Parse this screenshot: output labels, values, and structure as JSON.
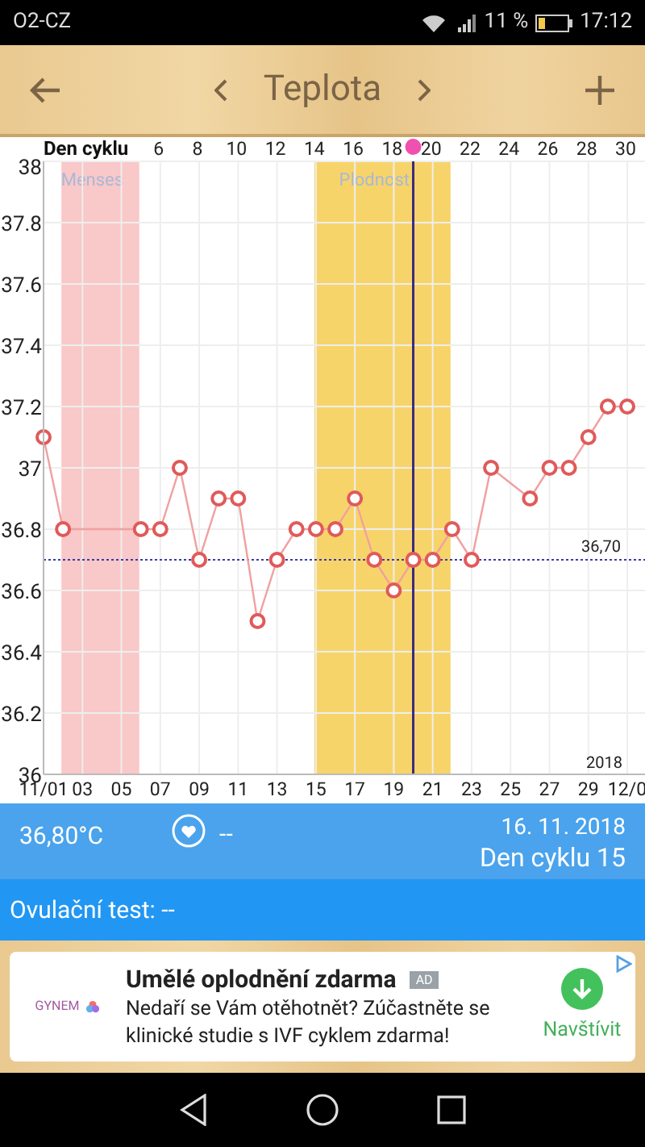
{
  "status_bar": {
    "carrier": "O2-CZ",
    "battery": "11 %",
    "time": "17:12"
  },
  "header": {
    "title": "Teplota"
  },
  "chart": {
    "chart_data": {
      "type": "line",
      "x": [
        1,
        2,
        3,
        4,
        5,
        6,
        7,
        8,
        9,
        10,
        11,
        12,
        13,
        14,
        15,
        16,
        17,
        18,
        19,
        20,
        21,
        22,
        23,
        24,
        25,
        26,
        27,
        28,
        29,
        30,
        31
      ],
      "grid": true,
      "series": [
        {
          "color": "#e05a5a",
          "marker": "o",
          "values": [
            37.1,
            36.8,
            null,
            null,
            null,
            36.8,
            36.8,
            37.0,
            36.7,
            36.9,
            36.9,
            36.5,
            36.7,
            36.8,
            36.8,
            36.8,
            36.9,
            36.7,
            36.6,
            36.7,
            36.7,
            36.8,
            36.7,
            37.0,
            null,
            36.9,
            37.0,
            37.0,
            37.1,
            37.2,
            37.2
          ]
        }
      ],
      "xlim": [
        1,
        31
      ],
      "ylim": [
        36,
        38
      ],
      "xticks": [
        {
          "value": 1,
          "label": "11/01"
        },
        {
          "value": 3,
          "label": "03"
        },
        {
          "value": 5,
          "label": "05"
        },
        {
          "value": 7,
          "label": "07"
        },
        {
          "value": 9,
          "label": "09"
        },
        {
          "value": 11,
          "label": "11"
        },
        {
          "value": 13,
          "label": "13"
        },
        {
          "value": 15,
          "label": "15"
        },
        {
          "value": 17,
          "label": "17"
        },
        {
          "value": 19,
          "label": "19"
        },
        {
          "value": 21,
          "label": "21"
        },
        {
          "value": 23,
          "label": "23"
        },
        {
          "value": 25,
          "label": "25"
        },
        {
          "value": 27,
          "label": "27"
        },
        {
          "value": 29,
          "label": "29"
        },
        {
          "value": 31,
          "label": "12/0"
        }
      ],
      "yticks": [
        {
          "value": 36,
          "label": "36"
        },
        {
          "value": 36.2,
          "label": "36.2"
        },
        {
          "value": 36.4,
          "label": "36.4"
        },
        {
          "value": 36.6,
          "label": "36.6"
        },
        {
          "value": 36.8,
          "label": "36.8"
        },
        {
          "value": 37,
          "label": "37"
        },
        {
          "value": 37.2,
          "label": "37.2"
        },
        {
          "value": 37.4,
          "label": "37.4"
        },
        {
          "value": 37.6,
          "label": "37.6"
        },
        {
          "value": 37.8,
          "label": "37.8"
        },
        {
          "value": 38,
          "label": "38"
        }
      ],
      "bands": [
        {
          "axis": "x",
          "from": 2,
          "to": 6,
          "label": "Menses",
          "color": "#f9c8c8"
        },
        {
          "axis": "x",
          "from": 15,
          "to": 22,
          "label": "Plodnost",
          "color": "#f7d469"
        }
      ],
      "ref_lines": [
        {
          "axis": "y",
          "value": 36.7,
          "label": "36,70",
          "color": "#3a3ab0"
        },
        {
          "axis": "x",
          "value": 20,
          "color": "#3a2a80"
        }
      ]
    },
    "cycle_axis": {
      "title": "Den cyklu",
      "ticks": [
        "6",
        "8",
        "10",
        "12",
        "14",
        "16",
        "18",
        "20",
        "22",
        "24",
        "26",
        "28",
        "30"
      ]
    },
    "year": "2018"
  },
  "info": {
    "temperature": "36,80°C",
    "intercourse": "--",
    "date": "16. 11. 2018",
    "cycle_day": "Den cyklu 15"
  },
  "ovulation": {
    "label": "Ovulační test: --"
  },
  "ad": {
    "brand": "GYNEM",
    "title": "Umělé oplodnění zdarma",
    "badge": "AD",
    "body": "Nedaří se Vám otěhotnět? Zúčastněte se klinické studie s IVF cyklem zdarma!",
    "action": "Navštívit"
  }
}
